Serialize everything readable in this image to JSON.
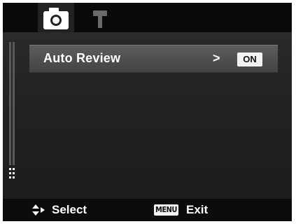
{
  "tabs": [
    {
      "name": "camera-icon",
      "active": true
    },
    {
      "name": "hammer-icon",
      "active": false
    }
  ],
  "menu": {
    "items": [
      {
        "label": "Auto Review",
        "arrow": ">",
        "value": "ON"
      }
    ]
  },
  "footer": {
    "select_label": "Select",
    "menu_badge": "MENU",
    "exit_label": "Exit",
    "nav_icon": "up-down-right-arrows-icon"
  },
  "colors": {
    "background": "#1b1b1b",
    "bar": "#0a0a0a",
    "highlight": "#555555",
    "text": "#ffffff",
    "badge": "#f2f2f2"
  }
}
